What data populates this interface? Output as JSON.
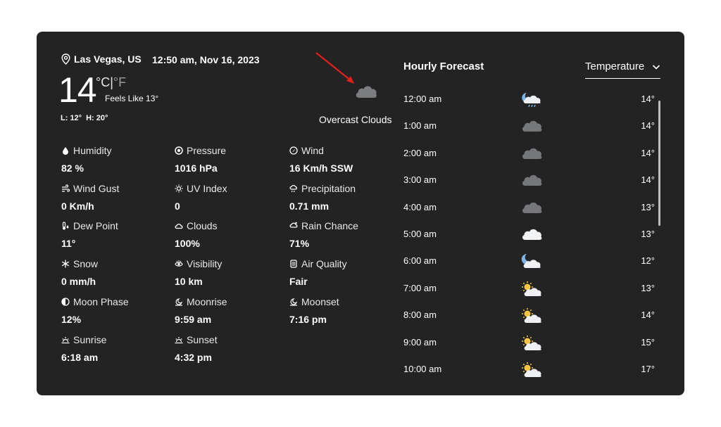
{
  "location": "Las Vegas, US",
  "datetime": "12:50 am, Nov 16, 2023",
  "current": {
    "temp": "14",
    "unit_c": "°C",
    "unit_sep": "|",
    "unit_f": "°F",
    "feels_like": "Feels Like 13°",
    "low": "L: 12°",
    "high": "H: 20°",
    "condition": "Overcast Clouds",
    "icon": "overcast-cloud-icon"
  },
  "metrics": [
    {
      "label": "Humidity",
      "value": "82 %",
      "icon": "humidity-icon"
    },
    {
      "label": "Pressure",
      "value": "1016 hPa",
      "icon": "pressure-icon"
    },
    {
      "label": "Wind",
      "value": "16 Km/h SSW",
      "icon": "wind-icon"
    },
    {
      "label": "Wind Gust",
      "value": "0 Km/h",
      "icon": "wind-gust-icon"
    },
    {
      "label": "UV Index",
      "value": "0",
      "icon": "uv-index-icon"
    },
    {
      "label": "Precipitation",
      "value": "0.71 mm",
      "icon": "precipitation-icon"
    },
    {
      "label": "Dew Point",
      "value": "11°",
      "icon": "dew-point-icon"
    },
    {
      "label": "Clouds",
      "value": "100%",
      "icon": "clouds-icon"
    },
    {
      "label": "Rain Chance",
      "value": "71%",
      "icon": "rain-chance-icon"
    },
    {
      "label": "Snow",
      "value": "0 mm/h",
      "icon": "snow-icon"
    },
    {
      "label": "Visibility",
      "value": "10 km",
      "icon": "visibility-icon"
    },
    {
      "label": "Air Quality",
      "value": "Fair",
      "icon": "air-quality-icon"
    },
    {
      "label": "Moon Phase",
      "value": "12%",
      "icon": "moon-phase-icon"
    },
    {
      "label": "Moonrise",
      "value": "9:59 am",
      "icon": "moonrise-icon"
    },
    {
      "label": "Moonset",
      "value": "7:16 pm",
      "icon": "moonset-icon"
    },
    {
      "label": "Sunrise",
      "value": "6:18 am",
      "icon": "sunrise-icon"
    },
    {
      "label": "Sunset",
      "value": "4:32 pm",
      "icon": "sunset-icon"
    }
  ],
  "hourly": {
    "title": "Hourly Forecast",
    "selected": "Temperature",
    "items": [
      {
        "time": "12:00 am",
        "temp": "14°",
        "icon": "night-rain-cloud-icon"
      },
      {
        "time": "1:00 am",
        "temp": "14°",
        "icon": "overcast-cloud-icon"
      },
      {
        "time": "2:00 am",
        "temp": "14°",
        "icon": "overcast-cloud-icon"
      },
      {
        "time": "3:00 am",
        "temp": "14°",
        "icon": "overcast-cloud-icon"
      },
      {
        "time": "4:00 am",
        "temp": "13°",
        "icon": "overcast-cloud-icon"
      },
      {
        "time": "5:00 am",
        "temp": "13°",
        "icon": "white-cloud-icon"
      },
      {
        "time": "6:00 am",
        "temp": "12°",
        "icon": "moon-cloud-icon"
      },
      {
        "time": "7:00 am",
        "temp": "13°",
        "icon": "sun-cloud-icon"
      },
      {
        "time": "8:00 am",
        "temp": "14°",
        "icon": "sun-cloud-icon"
      },
      {
        "time": "9:00 am",
        "temp": "15°",
        "icon": "sun-cloud-icon"
      },
      {
        "time": "10:00 am",
        "temp": "17°",
        "icon": "sun-cloud-icon"
      }
    ]
  },
  "colors": {
    "background": "#ffffff",
    "card": "#232323",
    "text": "#ffffff",
    "annotation_arrow": "#e0201b"
  }
}
